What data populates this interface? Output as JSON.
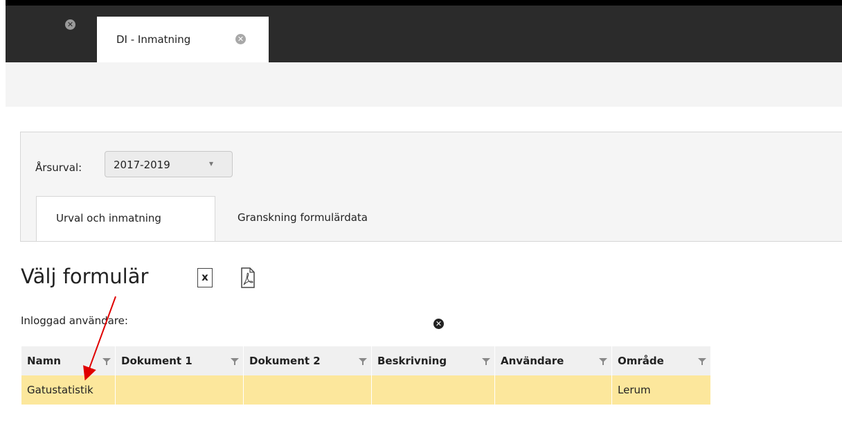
{
  "tabs": [
    {
      "label": ""
    },
    {
      "label": "DI - Inmatning"
    }
  ],
  "filter": {
    "label": "Årsurval:",
    "selected": "2017-2019"
  },
  "panel_tabs": [
    {
      "label": "Urval och inmatning"
    },
    {
      "label": "Granskning formulärdata"
    }
  ],
  "page_title": "Välj formulär",
  "icons": {
    "excel": "excel-export-icon",
    "pdf": "pdf-export-icon",
    "funnel": "filter-funnel-icon",
    "close": "close-circle-icon"
  },
  "user_label": "Inloggad användare:",
  "table": {
    "columns": [
      "Namn",
      "Dokument 1",
      "Dokument 2",
      "Beskrivning",
      "Användare",
      "Område"
    ],
    "rows": [
      [
        "Gatustatistik",
        "",
        "",
        "",
        "",
        "Lerum"
      ]
    ]
  },
  "colors": {
    "row_highlight": "#fce79c",
    "tabbar": "#2b2b2b",
    "annotation_arrow": "#e00000"
  }
}
